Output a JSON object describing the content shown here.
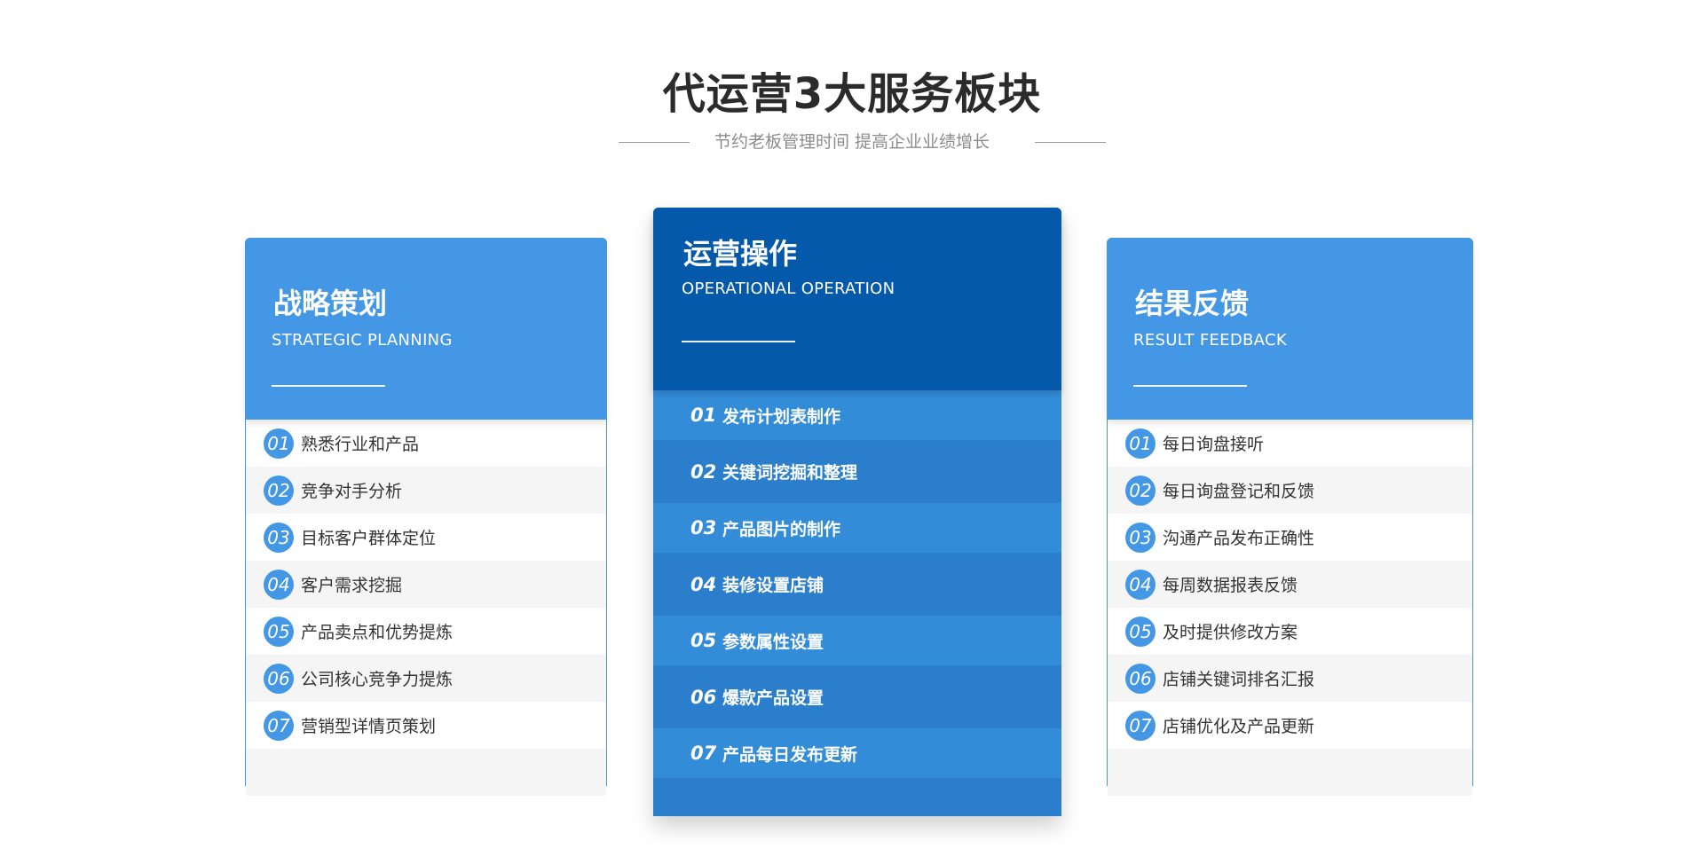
{
  "header": {
    "title": "代运营3大服务板块",
    "subtitle": "节约老板管理时间 提高企业业绩增长"
  },
  "cards": {
    "left": {
      "title_cn": "战略策划",
      "title_en": "STRATEGIC PLANNING",
      "items": [
        {
          "num": "01",
          "text": "熟悉行业和产品"
        },
        {
          "num": "02",
          "text": "竞争对手分析"
        },
        {
          "num": "03",
          "text": "目标客户群体定位"
        },
        {
          "num": "04",
          "text": "客户需求挖掘"
        },
        {
          "num": "05",
          "text": "产品卖点和优势提炼"
        },
        {
          "num": "06",
          "text": "公司核心竞争力提炼"
        },
        {
          "num": "07",
          "text": "营销型详情页策划"
        }
      ]
    },
    "center": {
      "title_cn": "运营操作",
      "title_en": "OPERATIONAL OPERATION",
      "items": [
        {
          "num": "01",
          "text": "发布计划表制作"
        },
        {
          "num": "02",
          "text": "关键词挖掘和整理"
        },
        {
          "num": "03",
          "text": "产品图片的制作"
        },
        {
          "num": "04",
          "text": "装修设置店铺"
        },
        {
          "num": "05",
          "text": "参数属性设置"
        },
        {
          "num": "06",
          "text": "爆款产品设置"
        },
        {
          "num": "07",
          "text": "产品每日发布更新"
        }
      ]
    },
    "right": {
      "title_cn": "结果反馈",
      "title_en": "RESULT FEEDBACK",
      "items": [
        {
          "num": "01",
          "text": "每日询盘接听"
        },
        {
          "num": "02",
          "text": "每日询盘登记和反馈"
        },
        {
          "num": "03",
          "text": "沟通产品发布正确性"
        },
        {
          "num": "04",
          "text": "每周数据报表反馈"
        },
        {
          "num": "05",
          "text": "及时提供修改方案"
        },
        {
          "num": "06",
          "text": "店铺关键词排名汇报"
        },
        {
          "num": "07",
          "text": "店铺优化及产品更新"
        }
      ]
    }
  },
  "colors": {
    "side_header": "#4497e4",
    "center_header": "#0459ab",
    "center_body": "#2a7ecb",
    "center_stripe": "#338cd8"
  }
}
